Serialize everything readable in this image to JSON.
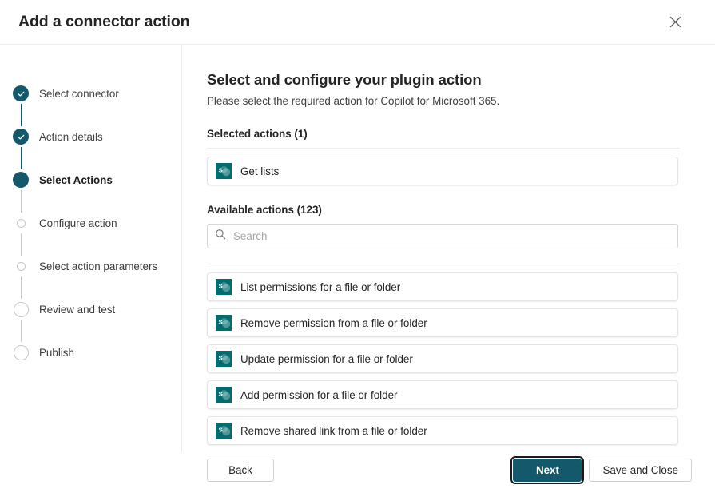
{
  "dialog": {
    "title": "Add a connector action",
    "close_label": "Close",
    "close_icon": "close-icon"
  },
  "wizard": {
    "steps": [
      {
        "label": "Select connector",
        "state": "done",
        "marker": "check-circle-icon"
      },
      {
        "label": "Action details",
        "state": "done",
        "marker": "check-circle-icon"
      },
      {
        "label": "Select Actions",
        "state": "current",
        "marker": "filled-circle-icon"
      },
      {
        "label": "Configure action",
        "state": "future",
        "marker": "small-empty-circle-icon"
      },
      {
        "label": "Select action parameters",
        "state": "future",
        "marker": "small-empty-circle-icon"
      },
      {
        "label": "Review and test",
        "state": "future",
        "marker": "large-empty-circle-icon"
      },
      {
        "label": "Publish",
        "state": "future",
        "marker": "large-empty-circle-icon"
      }
    ]
  },
  "main": {
    "title": "Select and configure your plugin action",
    "subtitle": "Please select the required action for Copilot for Microsoft 365.",
    "selected_label": "Selected actions (1)",
    "selected_actions": [
      {
        "name": "Get lists",
        "icon": "sharepoint-icon"
      }
    ],
    "available_label": "Available actions (123)",
    "search": {
      "placeholder": "Search",
      "value": "",
      "icon": "search-icon"
    },
    "available_actions": [
      {
        "name": "List permissions for a file or folder",
        "icon": "sharepoint-icon"
      },
      {
        "name": "Remove permission from a file or folder",
        "icon": "sharepoint-icon"
      },
      {
        "name": "Update permission for a file or folder",
        "icon": "sharepoint-icon"
      },
      {
        "name": "Add permission for a file or folder",
        "icon": "sharepoint-icon"
      },
      {
        "name": "Remove shared link from a file or folder",
        "icon": "sharepoint-icon"
      }
    ]
  },
  "footer": {
    "back_label": "Back",
    "next_label": "Next",
    "save_close_label": "Save and Close"
  },
  "colors": {
    "accent_teal": "#14596b",
    "sharepoint_teal": "#036c70",
    "border": "#e4e4e4",
    "text": "#242424"
  }
}
